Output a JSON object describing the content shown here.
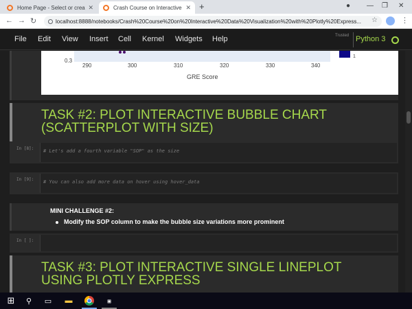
{
  "browser": {
    "tabs": [
      {
        "label": "Home Page - Select or create a n"
      },
      {
        "label": "Crash Course on Interactive Data"
      }
    ],
    "new_tab": "+",
    "url": "localhost:8888/notebooks/Crash%20Course%20on%20Interactive%20Data%20Visualization%20with%20Plotly%20Express...",
    "icons": {
      "back": "arrow-left-icon",
      "forward": "arrow-right-icon",
      "reload": "reload-icon",
      "star": "star-icon",
      "menu": "kebab-icon"
    }
  },
  "menubar": {
    "items": [
      "File",
      "Edit",
      "View",
      "Insert",
      "Cell",
      "Kernel",
      "Widgets",
      "Help"
    ],
    "trusted": "Trusted",
    "kernel": "Python 3"
  },
  "plot": {
    "y_tick": "0.3",
    "x_ticks": [
      "290",
      "300",
      "310",
      "320",
      "330",
      "340"
    ],
    "x_title": "GRE Score",
    "colorbar_label": "1"
  },
  "cells": {
    "task2_heading": "TASK #2: PLOT INTERACTIVE BUBBLE CHART (SCATTERPLOT WITH SIZE)",
    "code1_prompt": "In [8]:",
    "code1_text": "# Let's add a fourth variable \"SOP\" as the size",
    "code2_prompt": "In [9]:",
    "code2_text": "# You can also add more data on hover using hover_data",
    "challenge_title": "MINI CHALLENGE #2:",
    "challenge_item": "Modify the SOP column to make the bubble size variations more prominent",
    "code3_prompt": "In [ ]:",
    "task3_heading": "TASK #3: PLOT INTERACTIVE SINGLE LINEPLOT USING PLOTLY EXPRESS"
  },
  "colors": {
    "accent_green": "#a6d84c",
    "menubar_bg": "#1b1b1b",
    "cell_bg": "#2b2b2b"
  }
}
